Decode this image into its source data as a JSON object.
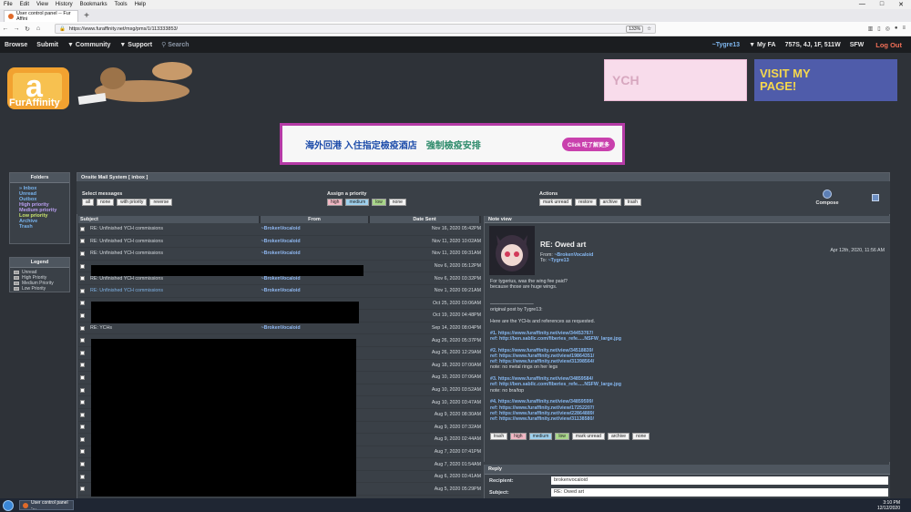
{
  "browser": {
    "menu": [
      "File",
      "Edit",
      "View",
      "History",
      "Bookmarks",
      "Tools",
      "Help"
    ],
    "window_controls": [
      "—",
      "□",
      "✕"
    ],
    "tab_title": "User control panel -- Fur Affini",
    "new_tab": "+",
    "url": "https://www.furaffinity.net/msg/pms/1/113333853/",
    "zoom": "133%"
  },
  "site_nav": {
    "browse": "Browse",
    "submit": "Submit",
    "community": "▼ Community",
    "support": "▼ Support",
    "search": "Search",
    "user": "~Tygre13",
    "myfa": "▼ My FA",
    "counts": "757S, 4J, 1F, 511W",
    "sfw": "SFW",
    "logout": "Log Out"
  },
  "logo_text": "FurAffinity",
  "banners": {
    "ych": "YCH",
    "visit": "VISIT MY PAGE!"
  },
  "ad": {
    "text1": "海外回港 入住指定檢疫酒店",
    "text2": "強制檢疫安排",
    "cta": "Click 咗了解更多"
  },
  "folders": {
    "title": "Folders",
    "items": [
      {
        "label": "» Inbox",
        "color": "blue"
      },
      {
        "label": "Unread",
        "color": "blue"
      },
      {
        "label": "Outbox",
        "color": "blue"
      },
      {
        "label": "",
        "color": "blue"
      },
      {
        "label": "High priority",
        "color": "purple"
      },
      {
        "label": "Medium priority",
        "color": "purple"
      },
      {
        "label": "Low priority",
        "color": "green"
      },
      {
        "label": "",
        "color": "blue"
      },
      {
        "label": "Archive",
        "color": "blue"
      },
      {
        "label": "Trash",
        "color": "blue"
      }
    ]
  },
  "legend": {
    "title": "Legend",
    "items": [
      "Unread",
      "High Priority",
      "Medium Priority",
      "Low Priority"
    ]
  },
  "mail": {
    "title": "Onsite Mail System [ inbox ]",
    "select_label": "Select messages",
    "select_btns": [
      "all",
      "none",
      "with priority",
      "reverse"
    ],
    "assign_label": "Assign a priority",
    "assign_btns": [
      "high",
      "medium",
      "low",
      "none"
    ],
    "actions_label": "Actions",
    "action_btns": [
      "mark unread",
      "restore",
      "archive",
      "trash"
    ],
    "compose": "Compose"
  },
  "table": {
    "headers": [
      "Subject",
      "From",
      "Date Sent"
    ],
    "rows": [
      {
        "subject": "RE: Unfinished YCH commissions",
        "from": "~BrokenVocaloid",
        "date": "Nov 16, 2020 05:42PM",
        "unread": false
      },
      {
        "subject": "RE: Unfinished YCH commissions",
        "from": "~BrokenVocaloid",
        "date": "Nov 11, 2020 10:02AM",
        "unread": false
      },
      {
        "subject": "RE: Unfinished YCH commissions",
        "from": "~BrokenVocaloid",
        "date": "Nov 11, 2020 09:31AM",
        "unread": false
      },
      {
        "subject": "",
        "from": "",
        "date": "Nov 6, 2020 05:12PM",
        "unread": false
      },
      {
        "subject": "RE: Unfinished YCH commissions",
        "from": "~BrokenVocaloid",
        "date": "Nov 6, 2020 03:32PM",
        "unread": false
      },
      {
        "subject": "RE: Unfinished YCH commissions",
        "from": "~BrokenVocaloid",
        "date": "Nov 1, 2020 09:21AM",
        "unread": true
      },
      {
        "subject": "",
        "from": "",
        "date": "Oct 25, 2020 03:06AM",
        "unread": false
      },
      {
        "subject": "",
        "from": "",
        "date": "Oct 19, 2020 04:48PM",
        "unread": false
      },
      {
        "subject": "RE: YCHs",
        "from": "~BrokenVocaloid",
        "date": "Sep 14, 2020 08:04PM",
        "unread": false
      },
      {
        "subject": "",
        "from": "",
        "date": "Aug 26, 2020 05:37PM",
        "unread": false
      },
      {
        "subject": "",
        "from": "",
        "date": "Aug 26, 2020 12:29AM",
        "unread": false
      },
      {
        "subject": "",
        "from": "",
        "date": "Aug 18, 2020 07:00AM",
        "unread": false
      },
      {
        "subject": "",
        "from": "",
        "date": "Aug 10, 2020 07:06AM",
        "unread": false
      },
      {
        "subject": "",
        "from": "",
        "date": "Aug 10, 2020 03:52AM",
        "unread": false
      },
      {
        "subject": "",
        "from": "",
        "date": "Aug 10, 2020 03:47AM",
        "unread": false
      },
      {
        "subject": "",
        "from": "",
        "date": "Aug 9, 2020 08:30AM",
        "unread": false
      },
      {
        "subject": "",
        "from": "",
        "date": "Aug 9, 2020 07:32AM",
        "unread": false
      },
      {
        "subject": "",
        "from": "",
        "date": "Aug 9, 2020 02:44AM",
        "unread": false
      },
      {
        "subject": "",
        "from": "",
        "date": "Aug 7, 2020 07:41PM",
        "unread": false
      },
      {
        "subject": "",
        "from": "",
        "date": "Aug 7, 2020 01:54AM",
        "unread": false
      },
      {
        "subject": "",
        "from": "",
        "date": "Aug 6, 2020 03:41AM",
        "unread": false
      },
      {
        "subject": "",
        "from": "",
        "date": "Aug 5, 2020 05:29PM",
        "unread": false
      }
    ]
  },
  "note": {
    "header": "Note view",
    "title": "RE: Owed art",
    "from_label": "From:",
    "from": "~BrokenVocaloid",
    "to_label": "To:",
    "to": "~Tygre13",
    "date": "Apr 12th, 2020, 11:56 AM",
    "lines": [
      {
        "t": "For tygerius, was the wing fee paid?",
        "u": false
      },
      {
        "t": "because those are huge wings.",
        "u": false
      },
      {
        "t": "",
        "u": false
      },
      {
        "t": "",
        "u": false
      },
      {
        "t": "—————————",
        "u": false
      },
      {
        "t": "original post by Tygre13:",
        "u": false
      },
      {
        "t": "",
        "u": false
      },
      {
        "t": "Here are the YCHs and references as requested.",
        "u": false
      },
      {
        "t": "",
        "u": false
      },
      {
        "t": "#1. https://www.furaffinity.net/view/34453767/",
        "u": true
      },
      {
        "t": "ref: http://ben.sabllc.com/fiberies_refe.....NSFW_large.jpg",
        "u": true
      },
      {
        "t": "",
        "u": false
      },
      {
        "t": "#2. https://www.furaffinity.net/view/34518839/",
        "u": true
      },
      {
        "t": "ref: https://www.furaffinity.net/view/19864351/",
        "u": true
      },
      {
        "t": "ref: https://www.furaffinity.net/view/31398564/",
        "u": true
      },
      {
        "t": "note: no metal rings on her legs",
        "u": false
      },
      {
        "t": "",
        "u": false
      },
      {
        "t": "#3. https://www.furaffinity.net/view/34859584/",
        "u": true
      },
      {
        "t": "ref: http://ben.sabllc.com/fiberies_refe.....NSFW_large.jpg",
        "u": true
      },
      {
        "t": "note: no bra/top",
        "u": false
      },
      {
        "t": "",
        "u": false
      },
      {
        "t": "#4. https://www.furaffinity.net/view/34859599/",
        "u": true
      },
      {
        "t": "ref: https://www.furaffinity.net/view/17252207/",
        "u": true
      },
      {
        "t": "ref: https://www.furaffinity.net/view/22864889/",
        "u": true
      },
      {
        "t": "ref: https://www.furaffinity.net/view/31138580/",
        "u": true
      }
    ],
    "buttons": [
      "trash",
      "high",
      "medium",
      "low",
      "mark unread",
      "archive",
      "none"
    ]
  },
  "reply": {
    "header": "Reply",
    "recipient_label": "Recipient:",
    "recipient": "brokenvocaloid",
    "subject_label": "Subject:",
    "subject": "RE: Owed art"
  },
  "taskbar": {
    "app": "User control panel -...",
    "time": "3:10 PM",
    "date": "12/12/2020"
  }
}
